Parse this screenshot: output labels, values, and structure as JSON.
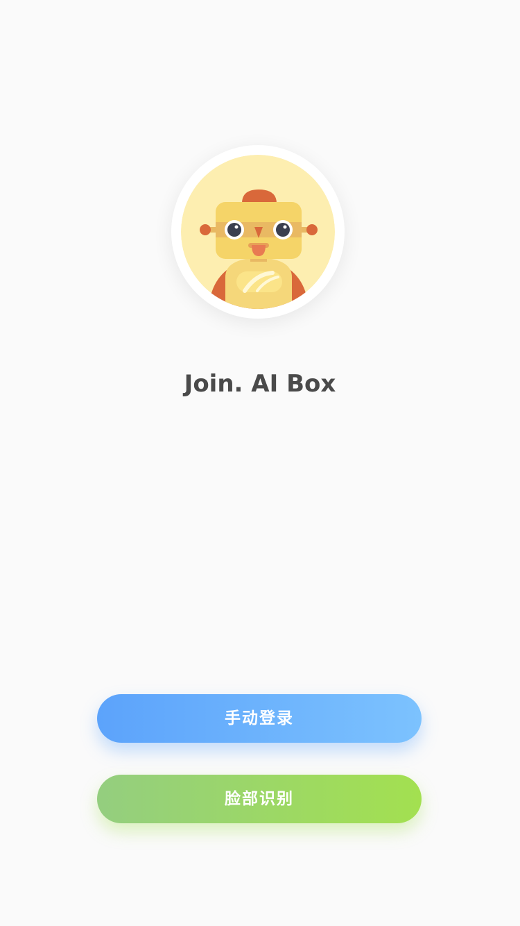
{
  "app": {
    "title": "Join. AI Box"
  },
  "avatar": {
    "icon": "robot-mascot-icon"
  },
  "buttons": {
    "manual_login": "手动登录",
    "face_recognition": "脸部识别"
  },
  "colors": {
    "background": "#fafafa",
    "title_text": "#4a4a4a",
    "manual_gradient_start": "#5ca3fb",
    "manual_gradient_end": "#7cc2fe",
    "face_gradient_start": "#94ce7f",
    "face_gradient_end": "#a3e050",
    "avatar_background": "#fdeeb0"
  }
}
